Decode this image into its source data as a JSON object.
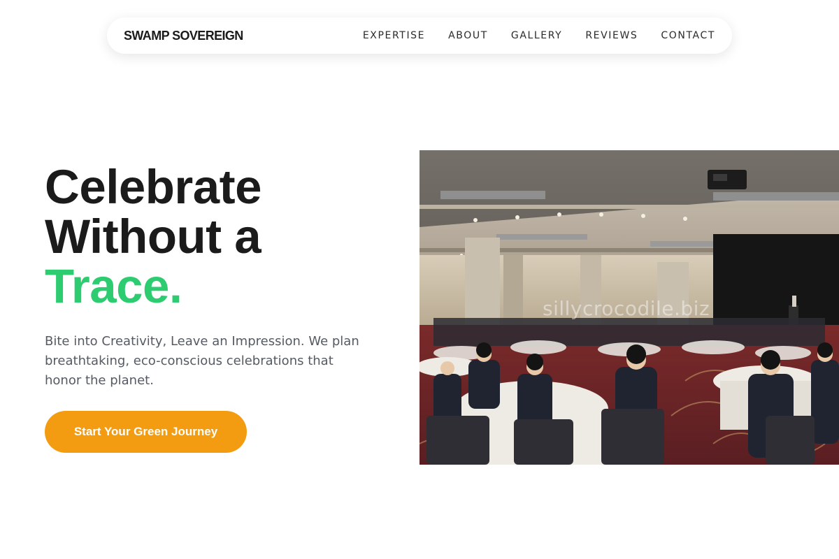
{
  "brand": "SWAMP SOVEREIGN",
  "nav": {
    "items": [
      {
        "label": "EXPERTISE"
      },
      {
        "label": "ABOUT"
      },
      {
        "label": "GALLERY"
      },
      {
        "label": "REVIEWS"
      },
      {
        "label": "CONTACT"
      }
    ]
  },
  "hero": {
    "headline_line1": "Celebrate",
    "headline_line2": "Without a",
    "headline_accent": "Trace.",
    "subtext": "Bite into Creativity, Leave an Impression. We plan breathtaking, eco-conscious celebrations that honor the planet.",
    "cta_label": "Start Your Green Journey",
    "image_watermark": "sillycrocodile.biz"
  },
  "colors": {
    "accent_green": "#2ecc71",
    "cta_orange": "#f39c12",
    "text_dark": "#1b1b1b",
    "text_muted": "#555a63"
  }
}
